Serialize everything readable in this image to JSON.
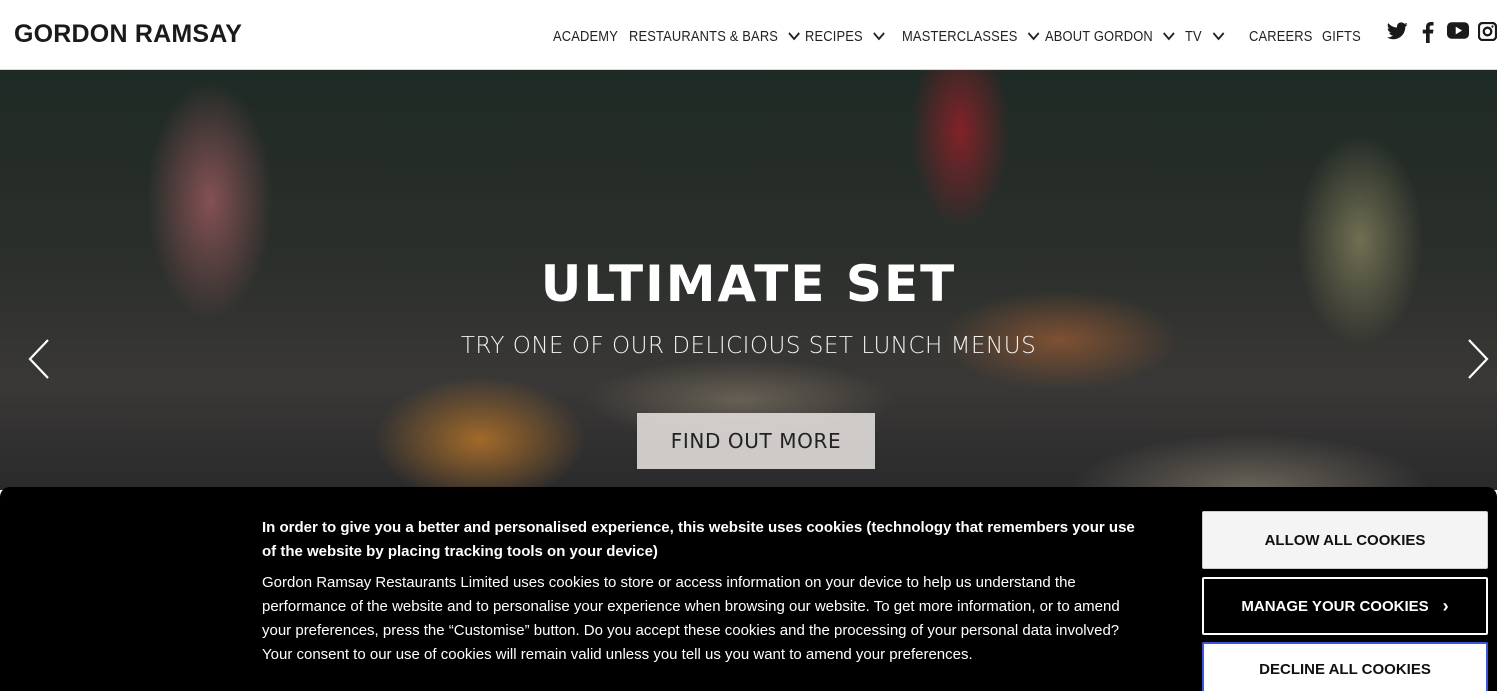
{
  "header": {
    "logo": "GORDON RAMSAY",
    "nav": [
      {
        "label": "ACADEMY",
        "dropdown": false
      },
      {
        "label": "RESTAURANTS & BARS",
        "dropdown": true
      },
      {
        "label": "RECIPES",
        "dropdown": true
      },
      {
        "label": "MASTERCLASSES",
        "dropdown": true
      },
      {
        "label": "ABOUT GORDON",
        "dropdown": true
      },
      {
        "label": "TV",
        "dropdown": true
      },
      {
        "label": "CAREERS",
        "dropdown": false
      },
      {
        "label": "GIFTS",
        "dropdown": false
      }
    ],
    "social_icons": [
      "twitter-icon",
      "facebook-icon",
      "youtube-icon",
      "instagram-icon"
    ]
  },
  "hero": {
    "title": "ULTIMATE SET",
    "subtitle": "TRY ONE OF OUR DELICIOUS SET LUNCH MENUS",
    "cta_label": "FIND OUT MORE",
    "prev_icon": "chevron-left-icon",
    "next_icon": "chevron-right-icon"
  },
  "cookie_banner": {
    "heading": "In order to give you a better and personalised experience, this website uses cookies (technology that remembers your use of the website by placing tracking tools on your device)",
    "body": "Gordon Ramsay Restaurants Limited uses cookies to store or access information on your device to help us understand the performance of the website and to personalise your experience when browsing our website. To get more information, or to amend your preferences, press the “Customise” button. Do you accept these cookies and the processing of your personal data involved? Your consent to our use of cookies will remain valid unless you tell us you want to amend your preferences.",
    "allow_label": "ALLOW ALL COOKIES",
    "manage_label": "MANAGE YOUR COOKIES",
    "decline_label": "DECLINE ALL COOKIES"
  },
  "colors": {
    "header_bg": "#ffffff",
    "banner_bg": "#000000",
    "focus_outline": "#3b57d8"
  }
}
